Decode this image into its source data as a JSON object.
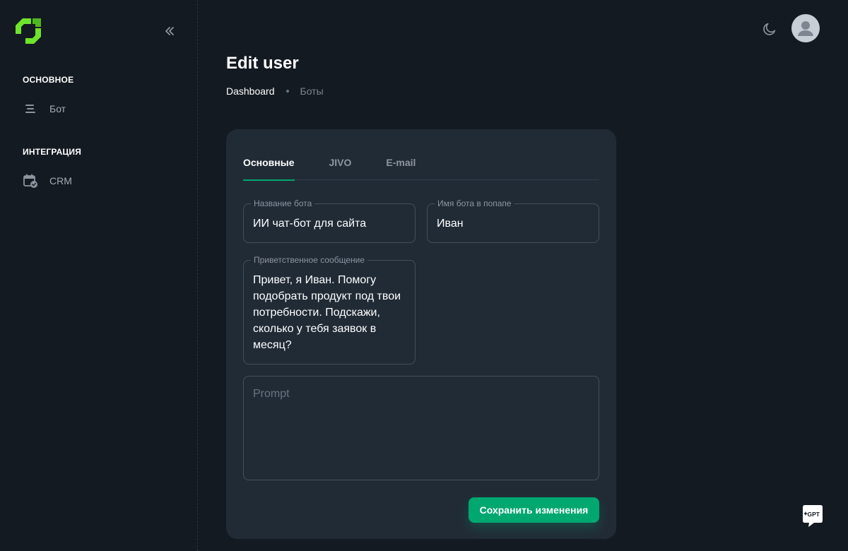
{
  "sidebar": {
    "sections": [
      {
        "title": "ОСНОВНОЕ",
        "items": [
          {
            "label": "Бот",
            "icon": "list-icon"
          }
        ]
      },
      {
        "title": "ИНТЕГРАЦИЯ",
        "items": [
          {
            "label": "CRM",
            "icon": "calendar-check-icon"
          }
        ]
      }
    ]
  },
  "header": {
    "title": "Edit user",
    "breadcrumb": {
      "root": "Dashboard",
      "current": "Боты"
    }
  },
  "tabs": [
    {
      "label": "Основные",
      "active": true
    },
    {
      "label": "JIVO",
      "active": false
    },
    {
      "label": "E-mail",
      "active": false
    }
  ],
  "form": {
    "bot_name": {
      "label": "Название бота",
      "value": "ИИ чат-бот для сайта"
    },
    "popup_name": {
      "label": "Имя бота в попапе",
      "value": "Иван"
    },
    "welcome": {
      "label": "Приветственное сообщение",
      "lines": [
        "Привет, я Иван. Помогу",
        "подобрать продукт под твои",
        "потребности. Подскажи,",
        "сколько у тебя заявок в",
        "месяц?"
      ]
    },
    "prompt": {
      "placeholder": "Prompt",
      "value": ""
    },
    "save_label": "Сохранить изменения"
  },
  "fab": {
    "label": "GPT"
  },
  "colors": {
    "background": "#141a21",
    "card": "#212b36",
    "accent": "#00a76f",
    "logo_green": "#6ee32b"
  }
}
